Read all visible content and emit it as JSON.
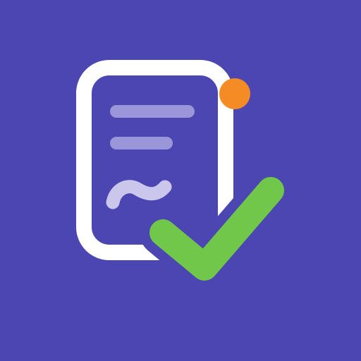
{
  "app_icon": {
    "icon_name": "signed-document-check-icon",
    "colors": {
      "background": "#4b46b2",
      "document_outline": "#ffffff",
      "document_fill": "#4b46b2",
      "text_lines": "#9b95d9",
      "signature": "#cac6ec",
      "checkmark": "#71c74a",
      "notification_dot": "#f48b25"
    }
  }
}
